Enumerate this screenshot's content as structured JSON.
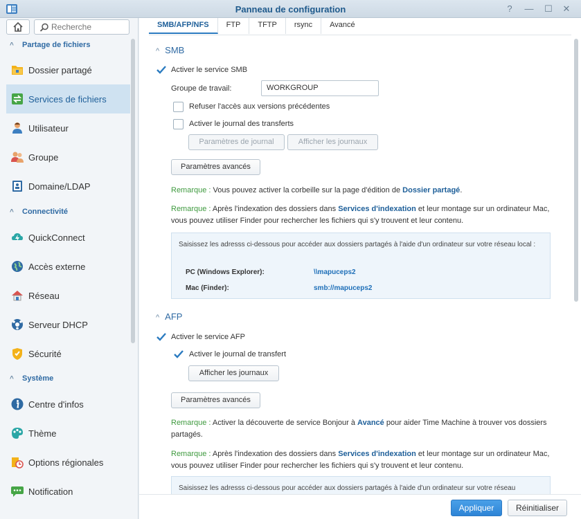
{
  "window": {
    "title": "Panneau de configuration",
    "controls": {
      "help": "?",
      "minimize": "—",
      "maximize": "☐",
      "close": "✕"
    }
  },
  "search": {
    "placeholder": "Recherche"
  },
  "sidebar": {
    "sections": [
      {
        "label": "Partage de fichiers"
      },
      {
        "label": "Connectivité"
      },
      {
        "label": "Système"
      }
    ],
    "items": [
      {
        "label": "Dossier partagé",
        "icon": "shared-folder-icon"
      },
      {
        "label": "Services de fichiers",
        "icon": "file-services-icon",
        "active": true
      },
      {
        "label": "Utilisateur",
        "icon": "user-icon"
      },
      {
        "label": "Groupe",
        "icon": "group-icon"
      },
      {
        "label": "Domaine/LDAP",
        "icon": "domain-icon"
      },
      {
        "label": "QuickConnect",
        "icon": "quickconnect-icon"
      },
      {
        "label": "Accès externe",
        "icon": "external-access-icon"
      },
      {
        "label": "Réseau",
        "icon": "network-icon"
      },
      {
        "label": "Serveur DHCP",
        "icon": "dhcp-icon"
      },
      {
        "label": "Sécurité",
        "icon": "security-icon"
      },
      {
        "label": "Centre d'infos",
        "icon": "info-center-icon"
      },
      {
        "label": "Thème",
        "icon": "theme-icon"
      },
      {
        "label": "Options régionales",
        "icon": "regional-options-icon"
      },
      {
        "label": "Notification",
        "icon": "notification-icon"
      }
    ]
  },
  "tabs": [
    {
      "label": "SMB/AFP/NFS",
      "active": true
    },
    {
      "label": "FTP"
    },
    {
      "label": "TFTP"
    },
    {
      "label": "rsync"
    },
    {
      "label": "Avancé"
    }
  ],
  "smb": {
    "title": "SMB",
    "enable_label": "Activer le service SMB",
    "enable_checked": true,
    "workgroup_label": "Groupe de travail:",
    "workgroup_value": "WORKGROUP",
    "deny_prev_label": "Refuser l'accès aux versions précédentes",
    "deny_prev_checked": false,
    "transfer_log_label": "Activer le journal des transferts",
    "transfer_log_checked": false,
    "log_settings_button": "Paramètres de journal",
    "view_logs_button": "Afficher les journaux",
    "advanced_button": "Paramètres avancés",
    "remark1": {
      "prefix": "Remarque :",
      "text_before": " Vous pouvez activer la corbeille sur la page d'édition de ",
      "link": "Dossier partagé",
      "text_after": "."
    },
    "remark2": {
      "prefix": "Remarque :",
      "text_before": " Après l'indexation des dossiers dans ",
      "link": "Services d'indexation",
      "text_after": " et leur montage sur un ordinateur Mac, vous pouvez utiliser Finder pour rechercher les fichiers qui s'y trouvent et leur contenu."
    },
    "info": {
      "text": "Saisissez les adresss ci-dessous pour accéder aux dossiers partagés à l'aide d'un ordinateur sur votre réseau local :",
      "pc_label": "PC (Windows Explorer):",
      "pc_value": "\\\\mapuceps2",
      "mac_label": "Mac (Finder):",
      "mac_value": "smb://mapuceps2"
    }
  },
  "afp": {
    "title": "AFP",
    "enable_label": "Activer le service AFP",
    "enable_checked": true,
    "transfer_log_label": "Activer le journal de transfert",
    "transfer_log_checked": true,
    "view_logs_button": "Afficher les journaux",
    "advanced_button": "Paramètres avancés",
    "remark1": {
      "prefix": "Remarque :",
      "text_before": " Activer la découverte de service Bonjour à ",
      "link": "Avancé",
      "text_after": " pour aider Time Machine à trouver vos dossiers partagés."
    },
    "remark2": {
      "prefix": "Remarque :",
      "text_before": " Après l'indexation des dossiers dans ",
      "link": "Services d'indexation",
      "text_after": " et leur montage sur un ordinateur Mac, vous pouvez utiliser Finder pour rechercher les fichiers qui s'y trouvent et leur contenu."
    },
    "info_text": "Saisissez les adresss ci-dessous pour accéder aux dossiers partagés à l'aide d'un ordinateur sur votre réseau"
  },
  "footer": {
    "apply_button": "Appliquer",
    "reset_button": "Réinitialiser"
  },
  "colors": {
    "accent": "#2b7bc0",
    "link": "#1e5f99",
    "remark": "#3f9a3f",
    "primary_button": "#3a90dd"
  }
}
